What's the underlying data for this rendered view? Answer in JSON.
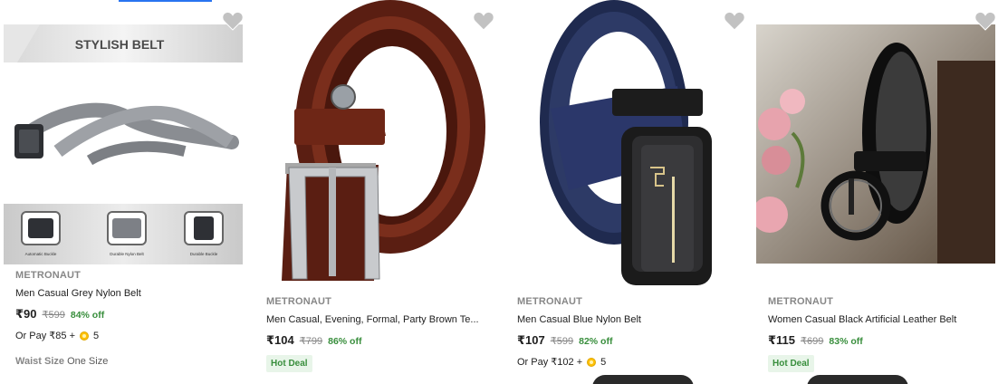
{
  "products": [
    {
      "brand": "METRONAUT",
      "title": "Men Casual Grey Nylon Belt",
      "price": "₹90",
      "mrp": "₹599",
      "discount": "84% off",
      "or_pay": "Or Pay ₹85 +",
      "coins": "5",
      "size_label": "Waist Size",
      "size_value": "One Size",
      "banner_text": "STYLISH BELT",
      "features": [
        "Automatic Buckle",
        "Durable Nylon Belt",
        "Durable Buckle"
      ]
    },
    {
      "brand": "METRONAUT",
      "title": "Men Casual, Evening, Formal, Party Brown Te...",
      "price": "₹104",
      "mrp": "₹799",
      "discount": "86% off",
      "badge": "Hot Deal"
    },
    {
      "brand": "METRONAUT",
      "title": "Men Casual Blue Nylon Belt",
      "price": "₹107",
      "mrp": "₹599",
      "discount": "82% off",
      "or_pay": "Or Pay ₹102 +",
      "coins": "5"
    },
    {
      "brand": "METRONAUT",
      "title": "Women Casual Black Artificial Leather Belt",
      "price": "₹115",
      "mrp": "₹699",
      "discount": "83% off",
      "badge": "Hot Deal"
    }
  ],
  "icons": {
    "wishlist": "heart-icon",
    "coin": "supercoin-icon"
  },
  "colors": {
    "discount": "#388e3c",
    "muted": "#878787",
    "accent": "#2874f0",
    "wishlist": "#c2c2c2"
  }
}
